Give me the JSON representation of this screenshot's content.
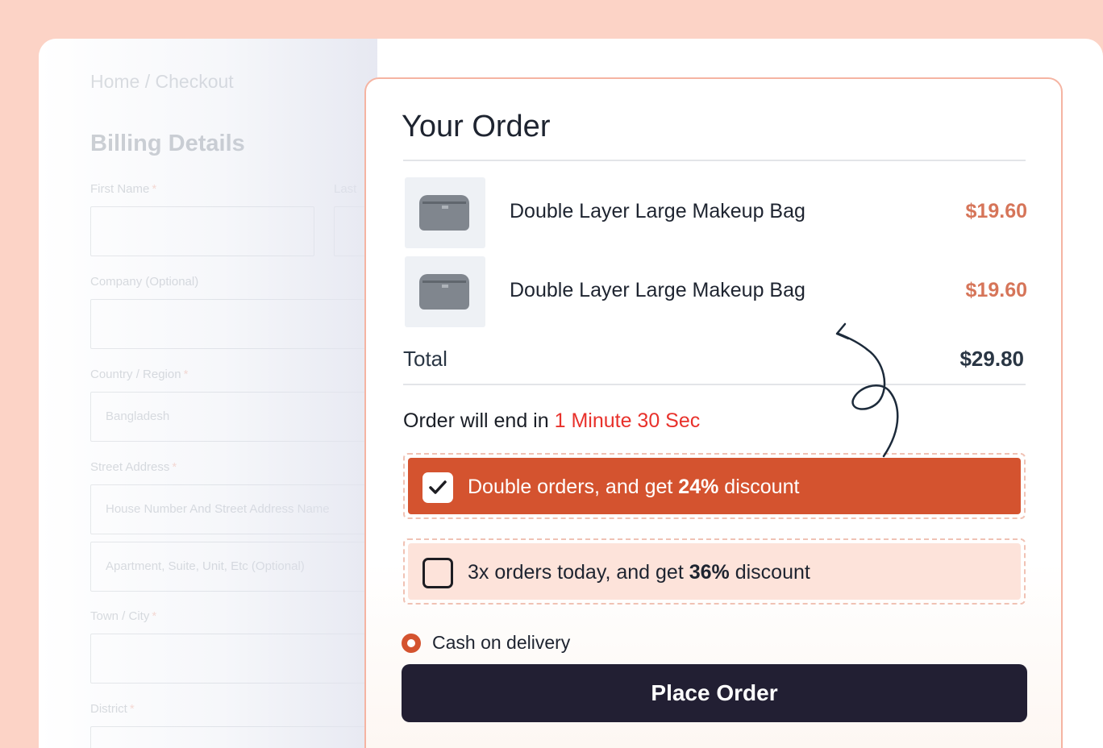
{
  "breadcrumb": "Home / Checkout",
  "billing": {
    "title": "Billing Details",
    "first_name_label": "First Name",
    "last_name_label": "Last",
    "company_label": "Company (Optional)",
    "country_label": "Country / Region",
    "country_value": "Bangladesh",
    "street_label": "Street Address",
    "street_placeholder": "House Number And Street Address Name",
    "apartment_placeholder": "Apartment, Suite, Unit, Etc (Optional)",
    "town_label": "Town / City",
    "district_label": "District",
    "required_mark": "*"
  },
  "order": {
    "title": "Your Order",
    "items": [
      {
        "name": "Double Layer Large Makeup Bag",
        "price": "$19.60"
      },
      {
        "name": "Double Layer Large Makeup Bag",
        "price": "$19.60"
      }
    ],
    "total_label": "Total",
    "total_value": "$29.80",
    "timer_prefix": "Order will end in",
    "timer_value": "1 Minute 30 Sec",
    "offers": [
      {
        "text_before": "Double orders, and get",
        "percent": "24%",
        "text_after": "discount",
        "checked": true
      },
      {
        "text_before": "3x orders today, and get",
        "percent": "36%",
        "text_after": "discount",
        "checked": false
      }
    ],
    "payment_label": "Cash on delivery",
    "place_order_label": "Place Order"
  },
  "colors": {
    "background": "#fcd3c6",
    "accent": "#d4532f",
    "price": "#d67559",
    "timer": "#e8312b",
    "button": "#221f33",
    "offer_highlight": "#fde3da"
  }
}
